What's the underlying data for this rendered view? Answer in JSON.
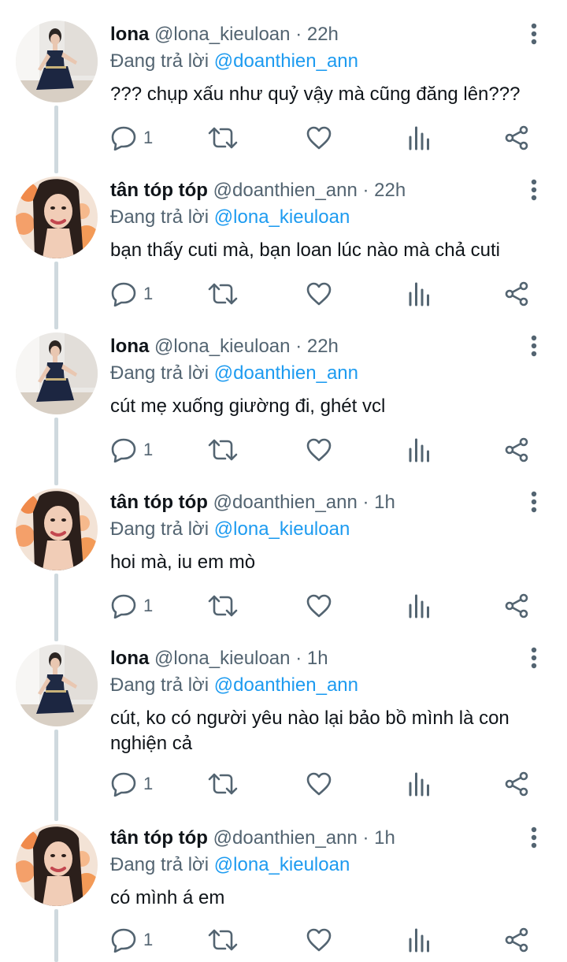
{
  "tweets": [
    {
      "name": "lona",
      "handle": "@lona_kieuloan",
      "time": "22h",
      "reply_prefix": "Đang trả lời",
      "reply_to": "@doanthien_ann",
      "text": "??? chụp xấu như quỷ vậy mà cũng đăng lên???",
      "replies": "1",
      "avatar": "lona"
    },
    {
      "name": "tân tóp tóp",
      "handle": "@doanthien_ann",
      "time": "22h",
      "reply_prefix": "Đang trả lời",
      "reply_to": "@lona_kieuloan",
      "text": "bạn thấy cuti mà, bạn loan lúc nào mà chả cuti",
      "replies": "1",
      "avatar": "tan"
    },
    {
      "name": "lona",
      "handle": "@lona_kieuloan",
      "time": "22h",
      "reply_prefix": "Đang trả lời",
      "reply_to": "@doanthien_ann",
      "text": "cút mẹ xuống giường đi, ghét vcl",
      "replies": "1",
      "avatar": "lona"
    },
    {
      "name": "tân tóp tóp",
      "handle": "@doanthien_ann",
      "time": "1h",
      "reply_prefix": "Đang trả lời",
      "reply_to": "@lona_kieuloan",
      "text": "hoi mà, iu em mò",
      "replies": "1",
      "avatar": "tan"
    },
    {
      "name": "lona",
      "handle": "@lona_kieuloan",
      "time": "1h",
      "reply_prefix": "Đang trả lời",
      "reply_to": "@doanthien_ann",
      "text": "cút, ko có người yêu nào lại bảo bồ mình là con nghiện cả",
      "replies": "1",
      "avatar": "lona"
    },
    {
      "name": "tân tóp tóp",
      "handle": "@doanthien_ann",
      "time": "1h",
      "reply_prefix": "Đang trả lời",
      "reply_to": "@lona_kieuloan",
      "text": "có mình á em",
      "replies": "1",
      "avatar": "tan"
    }
  ],
  "icons": {
    "more": "more-vertical-icon",
    "reply": "reply-icon",
    "retweet": "retweet-icon",
    "like": "heart-icon",
    "views": "analytics-icon",
    "share": "share-icon"
  },
  "colors": {
    "mention": "#1d9bf0",
    "secondary": "#536471",
    "thread_line": "#cfd9de"
  }
}
